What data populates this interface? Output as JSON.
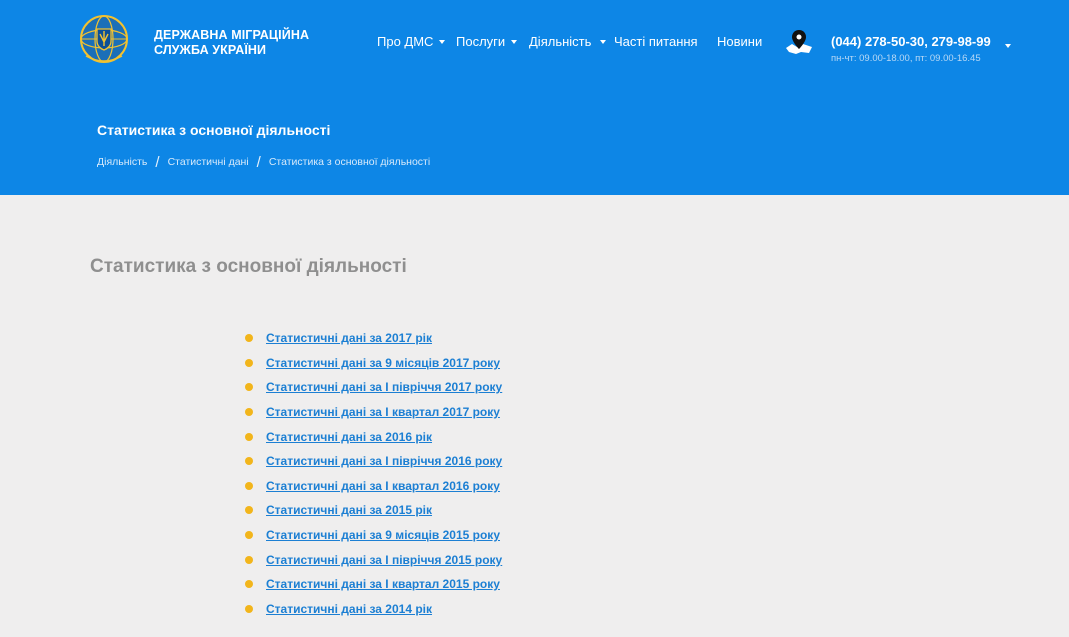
{
  "header": {
    "brand_line1": "ДЕРЖАВНА МІГРАЦІЙНА",
    "brand_line2": "СЛУЖБА УКРАЇНИ",
    "logo_icon": "coat-of-arms-emblem",
    "nav": [
      {
        "label": "Про ДМС",
        "has_dropdown": true
      },
      {
        "label": "Послуги",
        "has_dropdown": true
      },
      {
        "label": "Діяльність",
        "has_dropdown": true
      },
      {
        "label": "Часті питання",
        "has_dropdown": false
      },
      {
        "label": "Новини",
        "has_dropdown": false
      }
    ],
    "map_icon": "map-pin-icon",
    "phone": "(044) 278-50-30, 279-98-99",
    "hours": "пн-чт: 09.00-18.00, пт: 09.00-16.45"
  },
  "hero": {
    "title": "Статистика з основної діяльності",
    "breadcrumb": [
      "Діяльність",
      "Статистичні дані",
      "Статистика з основної діяльності"
    ]
  },
  "main": {
    "heading": "Статистика з основної діяльності",
    "links": [
      "Статистичні дані за 2017 рік",
      "Статистичні дані за 9 місяців 2017 року",
      "Статистичні дані за І півріччя 2017 року",
      "Статистичні дані за І квартал 2017 року",
      "Статистичні дані за 2016 рік",
      "Статистичні дані за І півріччя 2016 року",
      "Статистичні дані за І квартал 2016 року",
      "Статистичні дані за 2015 рік",
      "Статистичні дані за 9 місяців 2015 року",
      "Статистичні дані за І півріччя 2015 року",
      "Статистичні дані за І квартал 2015 року",
      "Статистичні дані за 2014 рік"
    ]
  },
  "colors": {
    "header_blue": "#0d86e6",
    "link_blue": "#1c7fd3",
    "bullet_yellow": "#f2b51b",
    "page_bg": "#efeeee"
  }
}
